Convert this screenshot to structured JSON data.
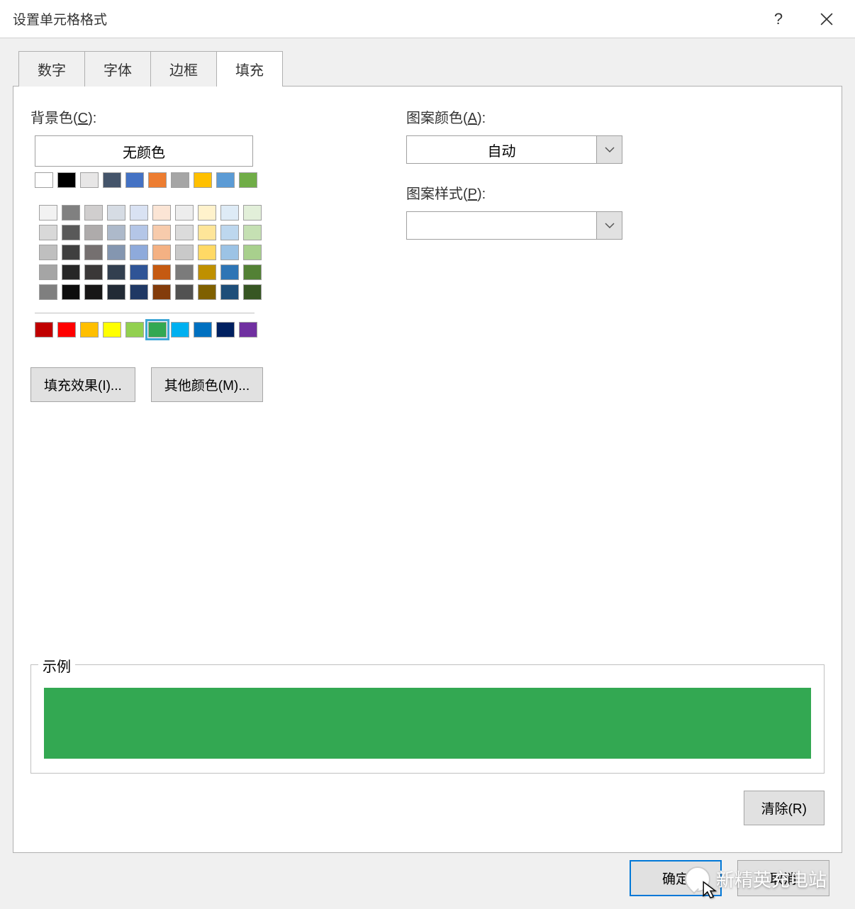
{
  "title": "设置单元格格式",
  "tabs": [
    "数字",
    "字体",
    "边框",
    "填充"
  ],
  "active_tab_index": 3,
  "fill": {
    "bg_label_prefix": "背景色(",
    "bg_label_hot": "C",
    "bg_label_suffix": "):",
    "no_color": "无颜色",
    "row1": [
      "#ffffff",
      "#000000",
      "#e7e6e6",
      "#44546a",
      "#4472c4",
      "#ed7d31",
      "#a5a5a5",
      "#ffc000",
      "#5b9bd5",
      "#70ad47"
    ],
    "theme_rows": [
      [
        "#f2f2f2",
        "#808080",
        "#d0cece",
        "#d6dce4",
        "#d9e2f3",
        "#fbe5d5",
        "#ededed",
        "#fff2cc",
        "#deebf6",
        "#e2efd9"
      ],
      [
        "#d8d8d8",
        "#595959",
        "#aeabab",
        "#adb9ca",
        "#b4c6e7",
        "#f7cbac",
        "#dbdbdb",
        "#fee599",
        "#bdd7ee",
        "#c5e0b3"
      ],
      [
        "#bfbfbf",
        "#3f3f3f",
        "#757070",
        "#8496b0",
        "#8eaadb",
        "#f4b183",
        "#c9c9c9",
        "#ffd965",
        "#9cc3e5",
        "#a8d08d"
      ],
      [
        "#a5a5a5",
        "#262626",
        "#3a3838",
        "#323f4f",
        "#2f5496",
        "#c55a11",
        "#7b7b7b",
        "#bf9000",
        "#2e75b5",
        "#538135"
      ],
      [
        "#7f7f7f",
        "#0c0c0c",
        "#171616",
        "#222a35",
        "#1f3864",
        "#833c0b",
        "#525252",
        "#7f6000",
        "#1e4e79",
        "#375623"
      ]
    ],
    "standard": [
      "#c00000",
      "#ff0000",
      "#ffbf00",
      "#ffff00",
      "#92d050",
      "#33a852",
      "#00b0f0",
      "#0070c0",
      "#002060",
      "#7030a0"
    ],
    "selected_standard_index": 5,
    "fill_effects_btn": "填充效果(I)...",
    "more_colors_btn": "其他颜色(M)...",
    "pattern_color_label_prefix": "图案颜色(",
    "pattern_color_hot": "A",
    "pattern_color_label_suffix": "):",
    "pattern_color_value": "自动",
    "pattern_style_label_prefix": "图案样式(",
    "pattern_style_hot": "P",
    "pattern_style_label_suffix": "):",
    "pattern_style_value": ""
  },
  "sample": {
    "legend": "示例",
    "color": "#33a852"
  },
  "clear_btn": "清除(R)",
  "ok_btn": "确定",
  "cancel_btn": "取消",
  "watermark": "新精英充电站"
}
